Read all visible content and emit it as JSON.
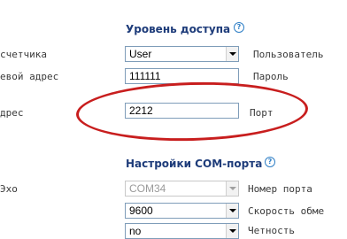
{
  "access_section": {
    "title": "Уровень доступа",
    "rows": [
      {
        "left_label": "счетчика",
        "value": "User",
        "right_label": "Пользователь"
      },
      {
        "left_label": "евой адрес",
        "value": "111111",
        "right_label": "Пароль"
      },
      {
        "left_label": "дрес",
        "value": "2212",
        "right_label": "Порт"
      }
    ]
  },
  "com_section": {
    "title": "Настройки COM-порта",
    "rows": [
      {
        "left_label": "Эхо",
        "value": "COM34",
        "right_label": "Номер порта"
      },
      {
        "left_label": "",
        "value": "9600",
        "right_label": "Скорость обме"
      },
      {
        "left_label": "",
        "value": "no",
        "right_label": "Четность"
      }
    ]
  },
  "help_icon_symbol": "?",
  "icons": [
    "help-icon",
    "chevron-down-icon"
  ],
  "colors": {
    "section_title": "#1e3c7a",
    "help_icon": "#2f7fc6",
    "annotation": "#c81e1e"
  }
}
